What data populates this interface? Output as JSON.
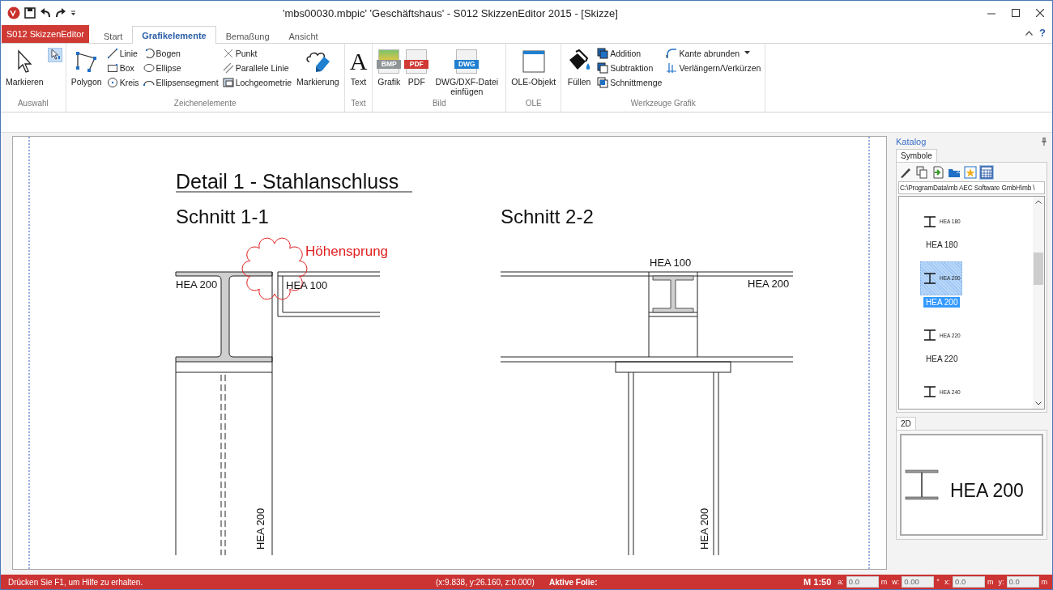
{
  "window": {
    "title": "'mbs00030.mbpic' 'Geschäftshaus' - S012 SkizzenEditor 2015 - [Skizze]"
  },
  "app_menu": {
    "label": "S012 SkizzenEditor"
  },
  "tabs": [
    {
      "label": "Start",
      "selected": false
    },
    {
      "label": "Grafikelemente",
      "selected": true
    },
    {
      "label": "Bemaßung",
      "selected": false
    },
    {
      "label": "Ansicht",
      "selected": false
    }
  ],
  "help": "?",
  "ribbon": {
    "groups": [
      {
        "label": "Auswahl",
        "items": [
          {
            "kind": "large",
            "label": "Markieren"
          },
          {
            "kind": "toggle",
            "selected": true
          }
        ]
      },
      {
        "label": "Zeichenelemente",
        "items": [
          {
            "kind": "large",
            "label": "Polygon"
          },
          {
            "kind": "column",
            "entries": [
              {
                "label": "Linie",
                "dropdown": false
              },
              {
                "label": "Box",
                "dropdown": false
              },
              {
                "label": "Kreis",
                "dropdown": false
              }
            ]
          },
          {
            "kind": "column",
            "entries": [
              {
                "label": "Bogen",
                "dropdown": false
              },
              {
                "label": "Ellipse",
                "dropdown": false
              },
              {
                "label": "Ellipsensegment",
                "dropdown": false
              }
            ]
          },
          {
            "kind": "column",
            "entries": [
              {
                "label": "Punkt",
                "dropdown": false
              },
              {
                "label": "Parallele Linie",
                "dropdown": false
              },
              {
                "label": "Lochgeometrie",
                "dropdown": false
              }
            ]
          },
          {
            "kind": "large",
            "label": "Markierung"
          }
        ]
      },
      {
        "label": "Text",
        "items": [
          {
            "kind": "large",
            "label": "Text",
            "glyph": "A"
          }
        ]
      },
      {
        "label": "Bild",
        "items": [
          {
            "kind": "large",
            "label": "Grafik",
            "badge": "BMP"
          },
          {
            "kind": "large",
            "label": "PDF",
            "badge": "PDF"
          },
          {
            "kind": "large",
            "label": "DWG/DXF-Datei einfügen",
            "badge": "DWG"
          }
        ]
      },
      {
        "label": "OLE",
        "items": [
          {
            "kind": "large",
            "label": "OLE-Objekt"
          }
        ]
      },
      {
        "label": "Werkzeuge Grafik",
        "items": [
          {
            "kind": "large",
            "label": "Füllen"
          },
          {
            "kind": "column",
            "entries": [
              {
                "label": "Addition",
                "dropdown": false
              },
              {
                "label": "Subtraktion",
                "dropdown": false
              },
              {
                "label": "Schnittmenge",
                "dropdown": false
              }
            ]
          },
          {
            "kind": "column",
            "entries": [
              {
                "label": "Kante abrunden",
                "dropdown": true
              },
              {
                "label": "Verlängern/Verkürzen",
                "dropdown": false
              }
            ]
          }
        ]
      }
    ]
  },
  "drawing": {
    "labels": [
      {
        "kind": "title",
        "text": "Detail 1 - Stahlanschluss"
      },
      {
        "kind": "heading",
        "text": "Schnitt 1-1"
      },
      {
        "kind": "heading",
        "text": "Schnitt 2-2"
      },
      {
        "kind": "annotation",
        "text": "Höhensprung"
      },
      {
        "kind": "profile",
        "text": "HEA 200"
      },
      {
        "kind": "profile",
        "text": "HEA 100"
      },
      {
        "kind": "profile-vertical",
        "text": "HEA 200"
      },
      {
        "kind": "profile",
        "text": "HEA 100"
      },
      {
        "kind": "profile",
        "text": "HEA 200"
      },
      {
        "kind": "profile-vertical",
        "text": "HEA 200"
      }
    ]
  },
  "catalog": {
    "title": "Katalog",
    "tabs": [
      {
        "label": "Symbole",
        "selected": true
      }
    ],
    "toolbar": [
      {
        "selected": false
      },
      {
        "selected": false
      },
      {
        "selected": false
      },
      {
        "selected": false
      },
      {
        "selected": false
      },
      {
        "selected": true
      }
    ],
    "path": "C:\\ProgramData\\mb AEC Software GmbH\\mb \\",
    "items": [
      {
        "symbol_label": "HEA 180",
        "caption": "HEA 180",
        "selected": false
      },
      {
        "symbol_label": "HEA 200",
        "caption": "HEA 200",
        "selected": true
      },
      {
        "symbol_label": "HEA 220",
        "caption": "HEA 220",
        "selected": false
      },
      {
        "symbol_label": "HEA 240",
        "selected": false
      }
    ]
  },
  "preview": {
    "tabs": [
      {
        "label": "2D",
        "selected": true
      }
    ],
    "label": "HEA 200"
  },
  "status_bar": {
    "message": "Drücken Sie F1, um Hilfe zu erhalten.",
    "coordinates": "(x:9.838, y:26.160, z:0.000)",
    "active_layer_label": "Aktive Folie:",
    "scale": "M 1:50",
    "fields": [
      {
        "label": "a:",
        "value": "0.0",
        "unit": "m"
      },
      {
        "label": "w:",
        "value": "0.00",
        "unit": "°"
      },
      {
        "label": "x:",
        "value": "0.0",
        "unit": "m"
      },
      {
        "label": "y:",
        "value": "0.0",
        "unit": "m"
      }
    ]
  }
}
